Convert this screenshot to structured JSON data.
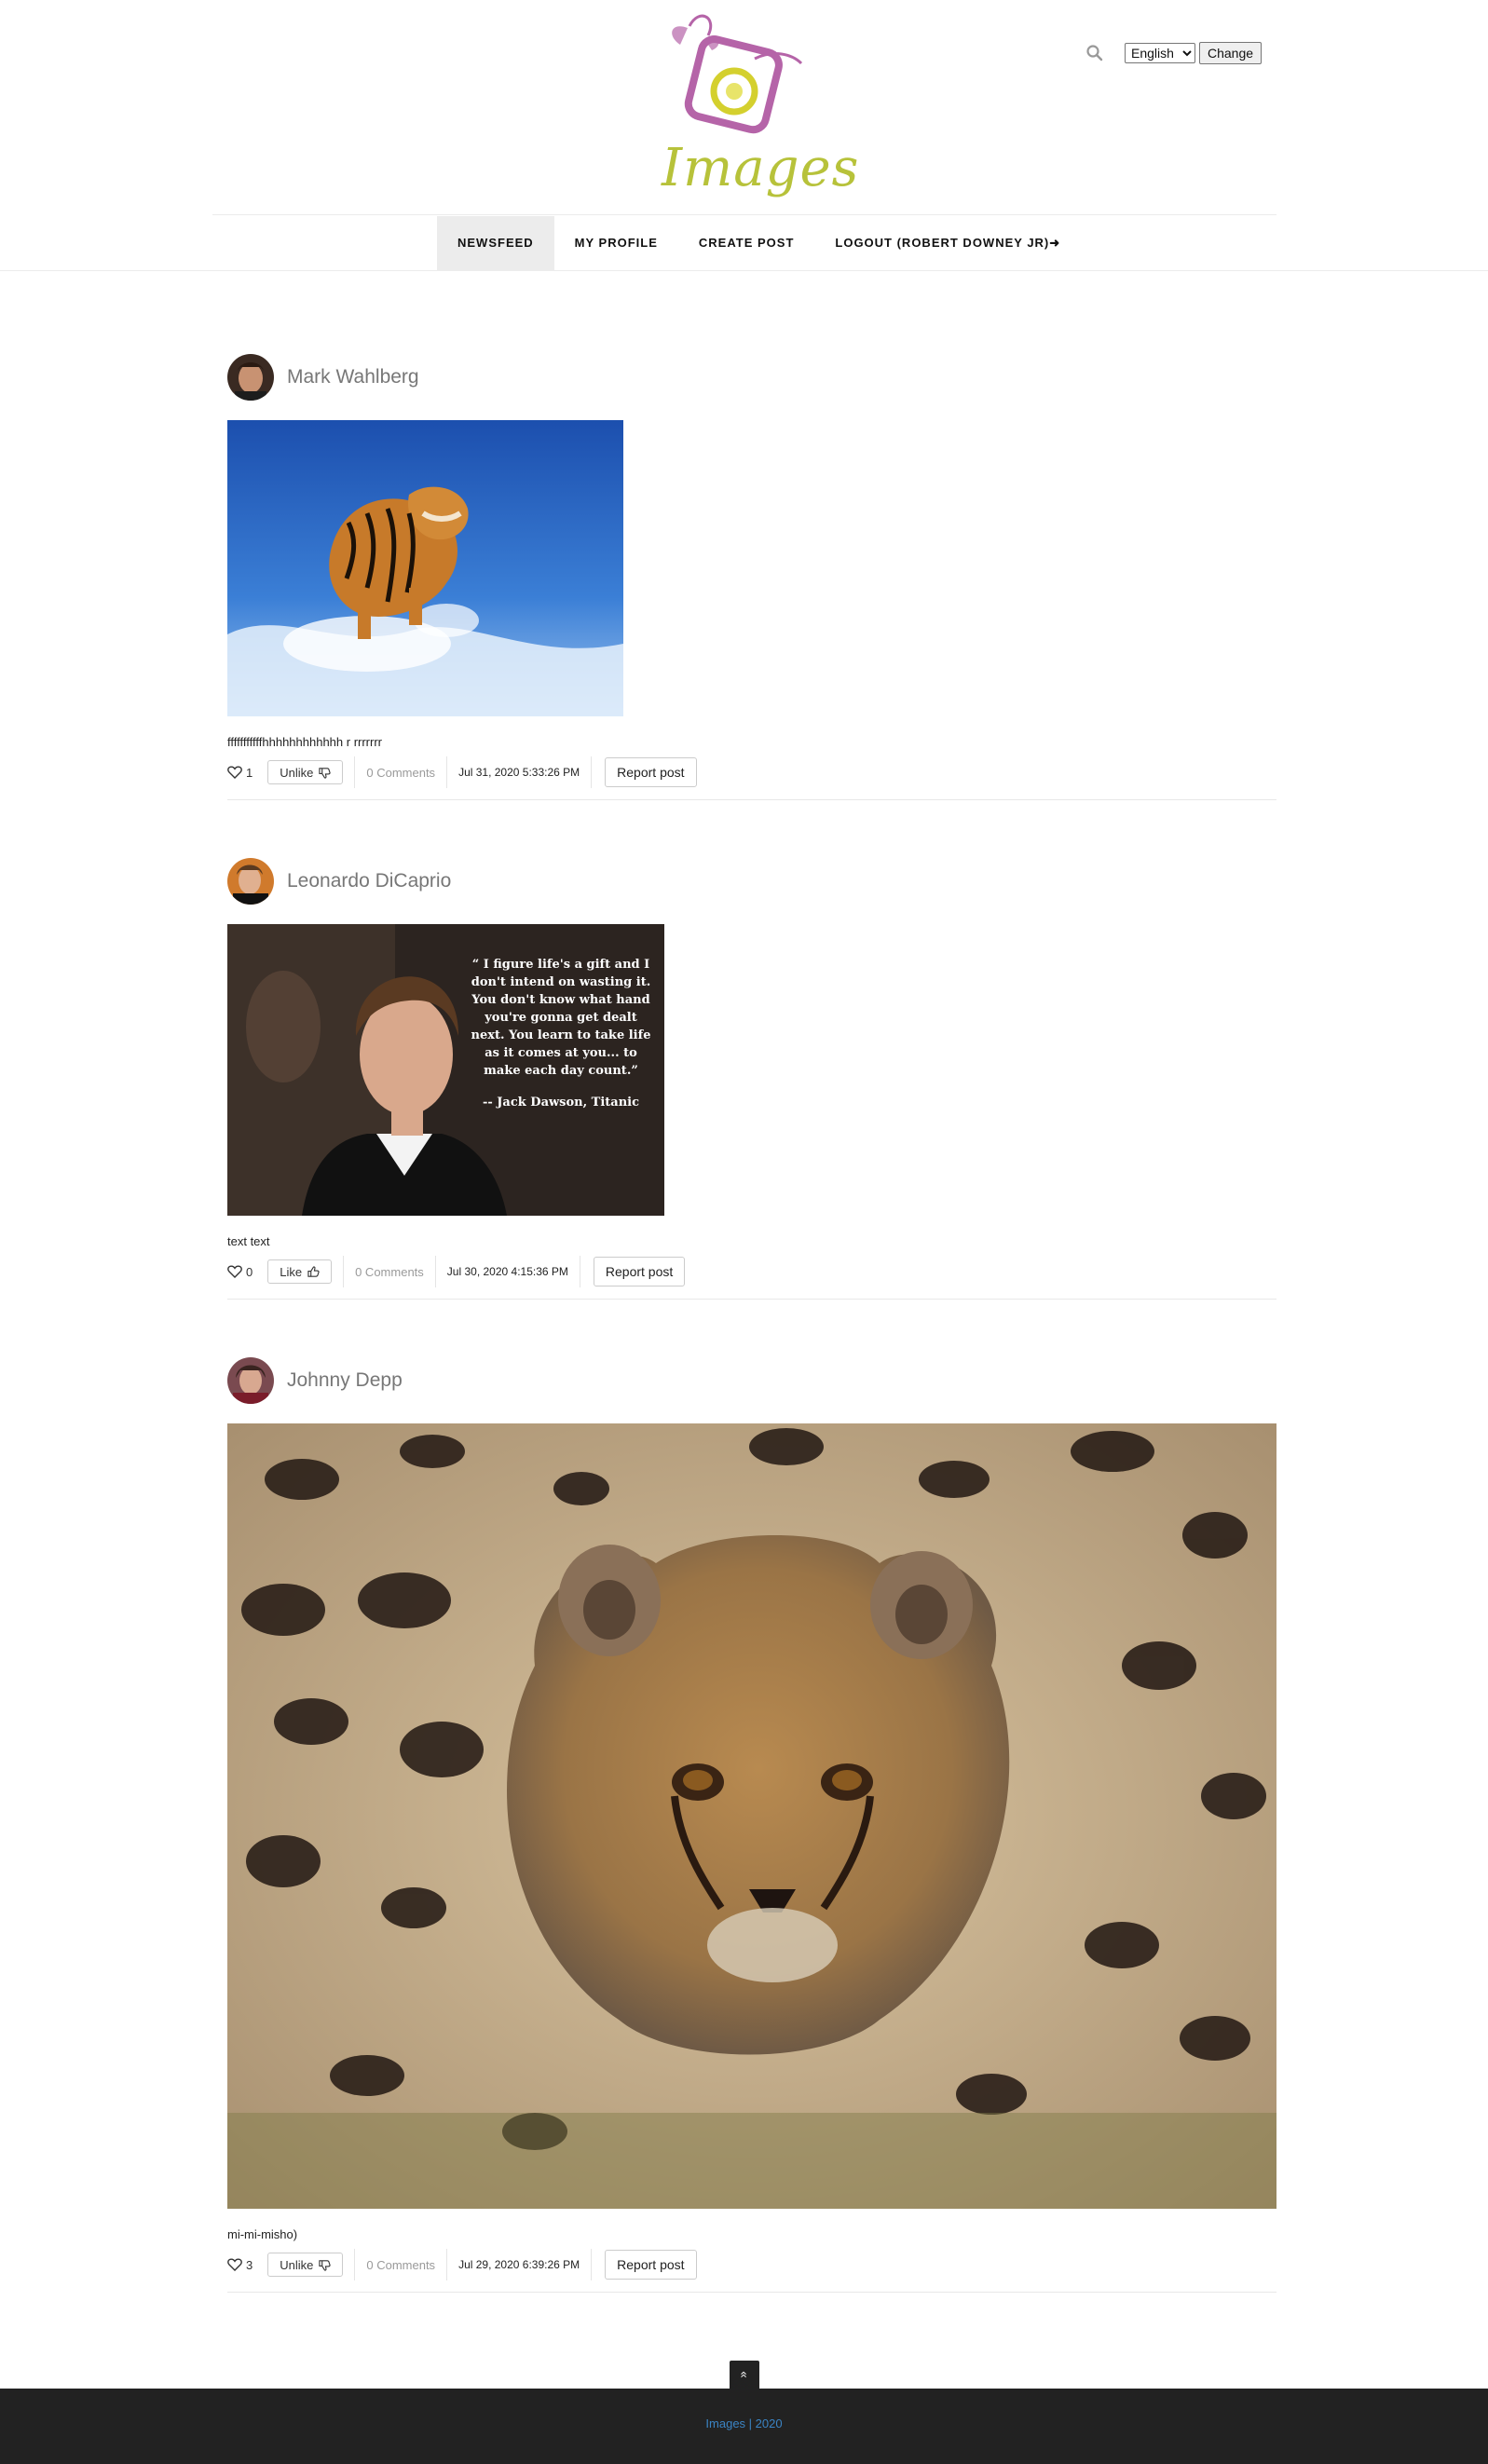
{
  "brand": {
    "logo_text": "Images"
  },
  "header": {
    "language": {
      "selected": "English",
      "options": [
        "English"
      ]
    },
    "change_label": "Change"
  },
  "nav": {
    "items": [
      {
        "label": "NEWSFEED",
        "active": true
      },
      {
        "label": "MY PROFILE",
        "active": false
      },
      {
        "label": "CREATE POST",
        "active": false
      },
      {
        "label": "LOGOUT (ROBERT DOWNEY JR)➜",
        "active": false
      }
    ]
  },
  "posts": [
    {
      "author": "Mark Wahlberg",
      "caption": "fffffffffffhhhhhhhhhhhh r rrrrrrr",
      "likes": "1",
      "like_button": "Unlike",
      "comments": "0 Comments",
      "date": "Jul 31, 2020 5:33:26 PM",
      "report": "Report post",
      "image_alt": "tiger running through water"
    },
    {
      "author": "Leonardo DiCaprio",
      "caption": "text text",
      "likes": "0",
      "like_button": "Like",
      "comments": "0 Comments",
      "date": "Jul 30, 2020 4:15:36 PM",
      "report": "Report post",
      "image_alt": "portrait with quote",
      "quote": "“ I figure life's a gift and I don't intend on wasting it. You don't know what hand you're gonna get dealt next. You learn to take life as it comes at you... to make each day count.”",
      "quote_author": "-- Jack Dawson, Titanic"
    },
    {
      "author": "Johnny Depp",
      "caption": "mi-mi-misho)",
      "likes": "3",
      "like_button": "Unlike",
      "comments": "0 Comments",
      "date": "Jul 29, 2020 6:39:26 PM",
      "report": "Report post",
      "image_alt": "cheetah cub"
    }
  ],
  "footer": {
    "text": "Images | 2020",
    "to_top": "«"
  },
  "colors": {
    "logo_purple": "#b564a8",
    "logo_yellow": "#d4d02e",
    "footer_bg": "#222222",
    "footer_link": "#3b84c4"
  }
}
